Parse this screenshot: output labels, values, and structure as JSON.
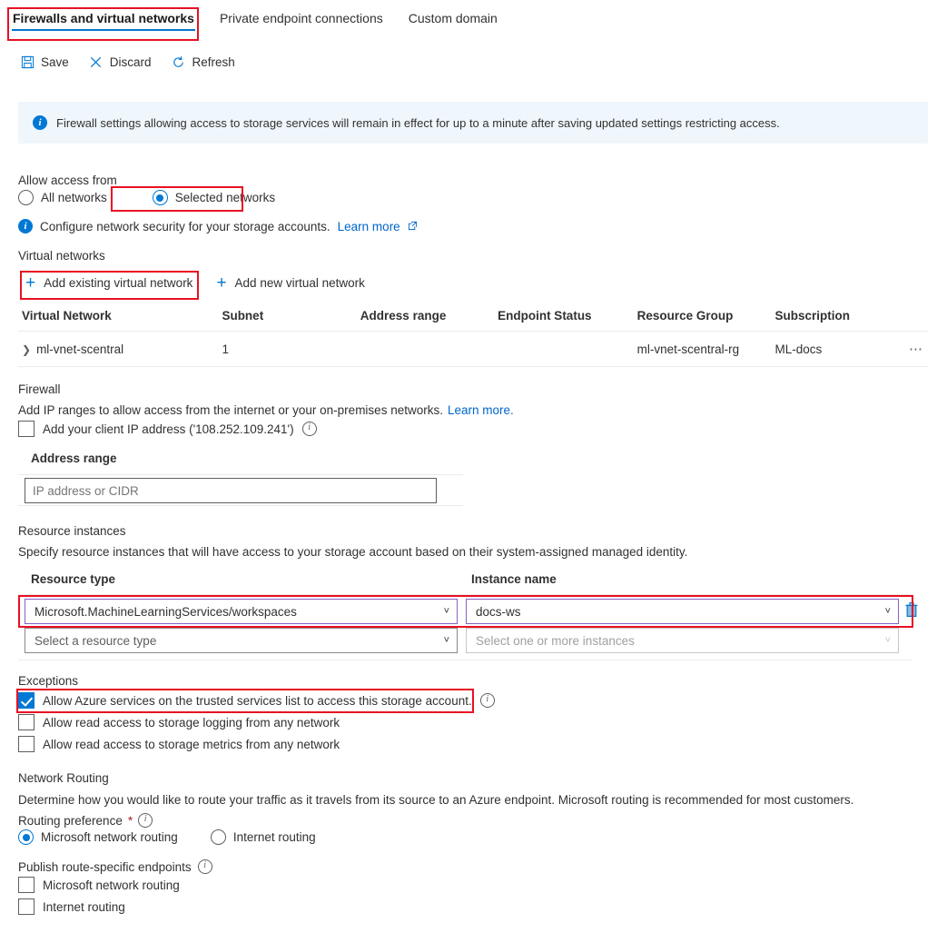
{
  "tabs": [
    {
      "label": "Firewalls and virtual networks",
      "selected": true
    },
    {
      "label": "Private endpoint connections",
      "selected": false
    },
    {
      "label": "Custom domain",
      "selected": false
    }
  ],
  "commandbar": {
    "save": "Save",
    "discard": "Discard",
    "refresh": "Refresh",
    "icons": [
      "save-icon",
      "discard-icon",
      "refresh-icon"
    ]
  },
  "banner": {
    "icon": "info-icon",
    "text": "Firewall settings allowing access to storage services will remain in effect for up to a minute after saving updated settings restricting access.",
    "background": "#eff6fc"
  },
  "allow_access": {
    "label": "Allow access from",
    "options": [
      {
        "label": "All networks",
        "selected": false
      },
      {
        "label": "Selected networks",
        "selected": true
      }
    ],
    "hint_icon": "info-icon",
    "hint_text": "Configure network security for your storage accounts.",
    "hint_link": "Learn more",
    "hint_link_icon": "external-link-icon"
  },
  "virtual_networks": {
    "heading": "Virtual networks",
    "add_existing": "Add existing virtual network",
    "add_new": "Add new virtual network",
    "columns": [
      "Virtual Network",
      "Subnet",
      "Address range",
      "Endpoint Status",
      "Resource Group",
      "Subscription"
    ],
    "rows": [
      {
        "expand_icon": "chevron-right-icon",
        "virtual_network": "ml-vnet-scentral",
        "subnet": "1",
        "address_range": "",
        "endpoint_status": "",
        "resource_group": "ml-vnet-scentral-rg",
        "subscription": "ML-docs",
        "more_icon": "ellipsis-icon"
      }
    ]
  },
  "firewall": {
    "heading": "Firewall",
    "description": "Add IP ranges to allow access from the internet or your on-premises networks.",
    "description_link": "Learn more.",
    "client_ip_checkbox": {
      "label": "Add your client IP address ('108.252.109.241')",
      "checked": false,
      "info_icon": "info-icon"
    },
    "address_range_label": "Address range",
    "address_range_placeholder": "IP address or CIDR",
    "address_range_value": ""
  },
  "resource_instances": {
    "heading": "Resource instances",
    "description": "Specify resource instances that will have access to your storage account based on their system-assigned managed identity.",
    "col_resource_type": "Resource type",
    "col_instance_name": "Instance name",
    "rows": [
      {
        "resource_type": "Microsoft.MachineLearningServices/workspaces",
        "instance_name": "docs-ws",
        "delete_icon": "trash-icon",
        "highlighted": true
      },
      {
        "resource_type_placeholder": "Select a resource type",
        "instance_name_placeholder": "Select one or more instances",
        "highlighted": false
      }
    ],
    "caret_icon": "chevron-down-icon"
  },
  "exceptions": {
    "heading": "Exceptions",
    "items": [
      {
        "label": "Allow Azure services on the trusted services list to access this storage account.",
        "checked": true,
        "info_icon": "info-icon"
      },
      {
        "label": "Allow read access to storage logging from any network",
        "checked": false
      },
      {
        "label": "Allow read access to storage metrics from any network",
        "checked": false
      }
    ]
  },
  "network_routing": {
    "heading": "Network Routing",
    "description": "Determine how you would like to route your traffic as it travels from its source to an Azure endpoint. Microsoft routing is recommended for most customers.",
    "routing_preference_label": "Routing preference",
    "required_marker": "*",
    "info_icon": "info-icon",
    "options": [
      {
        "label": "Microsoft network routing",
        "selected": true
      },
      {
        "label": "Internet routing",
        "selected": false
      }
    ],
    "publish_label": "Publish route-specific endpoints",
    "publish_info_icon": "info-icon",
    "publish_items": [
      {
        "label": "Microsoft network routing",
        "checked": false
      },
      {
        "label": "Internet routing",
        "checked": false
      }
    ]
  },
  "colors": {
    "accent": "#0078d4",
    "annotation": "#e81123",
    "banner_bg": "#eff6fc",
    "dropdown_border": "#8661c5",
    "link": "#0066cc"
  }
}
